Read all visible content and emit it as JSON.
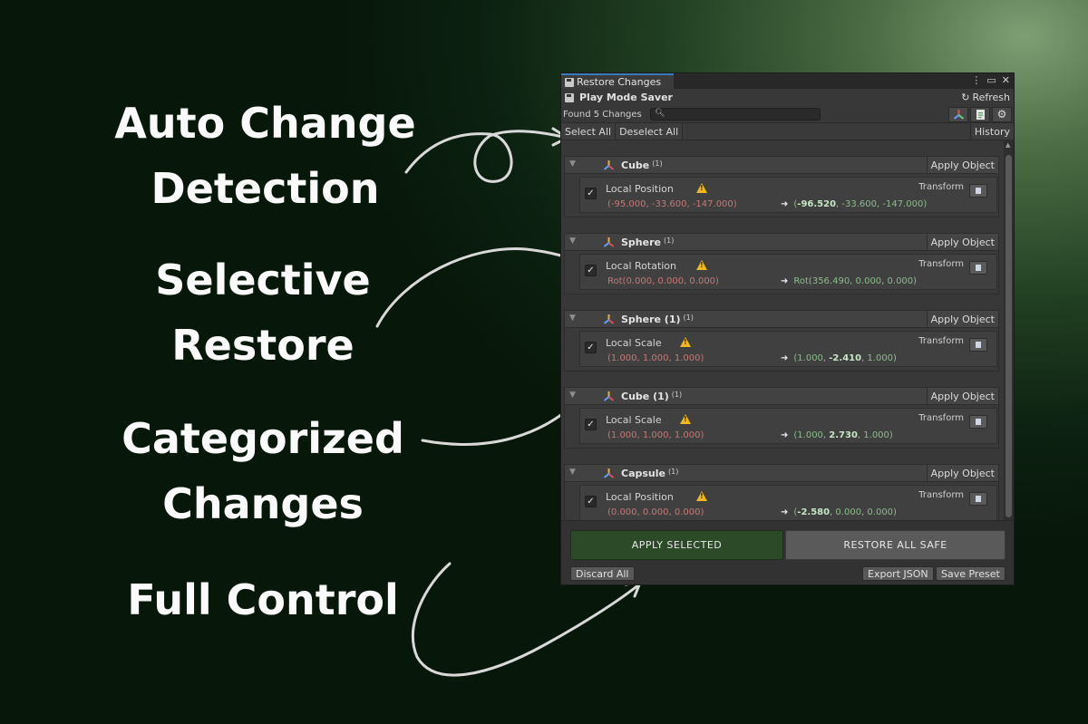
{
  "promo": {
    "auto_line1": "Auto Change",
    "auto_line2": "Detection",
    "selective_line1": "Selective",
    "selective_line2": "Restore",
    "categorized_line1": "Categorized",
    "categorized_line2": "Changes",
    "full_control": "Full Control"
  },
  "window": {
    "tab_title": "Restore Changes",
    "app_title": "Play Mode Saver",
    "refresh_label": "Refresh",
    "found_text": "Found 5 Changes",
    "search_value": "",
    "search_placeholder": "",
    "select_all": "Select All",
    "deselect_all": "Deselect All",
    "history": "History",
    "icons": [
      "gizmo-icon",
      "document-icon",
      "gear-icon"
    ]
  },
  "groups": [
    {
      "name": "Cube",
      "count": "(1)",
      "apply": "Apply Object",
      "checked": true,
      "property": "Local Position",
      "component": "Transform",
      "old": "(-95.000, -33.600, -147.000)",
      "new_pre": "(",
      "new_bold": "-96.520",
      "new_post": ", -33.600, -147.000)"
    },
    {
      "name": "Sphere",
      "count": "(1)",
      "apply": "Apply Object",
      "checked": true,
      "property": "Local Rotation",
      "component": "Transform",
      "old": "Rot(0.000, 0.000, 0.000)",
      "new_pre": "Rot(356.490, 0.000, 0.000)",
      "new_bold": "",
      "new_post": ""
    },
    {
      "name": "Sphere (1)",
      "count": "(1)",
      "apply": "Apply Object",
      "checked": true,
      "property": "Local Scale",
      "component": "Transform",
      "old": "(1.000, 1.000, 1.000)",
      "new_pre": "(1.000, ",
      "new_bold": "-2.410",
      "new_post": ", 1.000)"
    },
    {
      "name": "Cube (1)",
      "count": "(1)",
      "apply": "Apply Object",
      "checked": true,
      "property": "Local Scale",
      "component": "Transform",
      "old": "(1.000, 1.000, 1.000)",
      "new_pre": "(1.000, ",
      "new_bold": "2.730",
      "new_post": ", 1.000)"
    },
    {
      "name": "Capsule",
      "count": "(1)",
      "apply": "Apply Object",
      "checked": true,
      "property": "Local Position",
      "component": "Transform",
      "old": "(0.000, 0.000, 0.000)",
      "new_pre": "(",
      "new_bold": "-2.580",
      "new_post": ", 0.000, 0.000)"
    }
  ],
  "footer": {
    "apply_selected": "APPLY SELECTED",
    "restore_all_safe": "RESTORE ALL SAFE",
    "discard_all": "Discard All",
    "export_json": "Export JSON",
    "save_preset": "Save Preset"
  },
  "colors": {
    "apply_selected_bg": "#2c4a27",
    "old_value": "#c67878",
    "new_value": "#8dbb8d",
    "warning": "#f0b81a",
    "tab_accent": "#3a79bb"
  }
}
